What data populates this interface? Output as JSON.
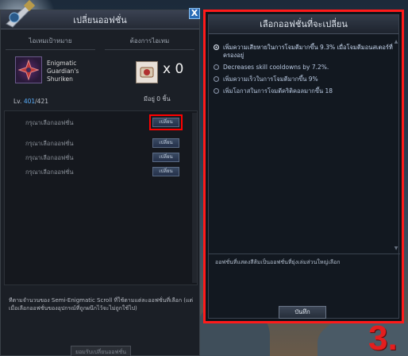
{
  "left_panel": {
    "title": "เปลี่ยนออฟชั่น",
    "close_label": "X",
    "col_headers": [
      "ไอเทมเป้าหมาย",
      "ต้องการไอเทม"
    ],
    "item": {
      "name": "Enigmatic Guardian's Shuriken",
      "level_prefix": "Lv.",
      "level_current": "401",
      "level_max": "/421"
    },
    "scroll": {
      "count": "x 0",
      "owned": "มีอยู่ 0 ชิ้น"
    },
    "options": [
      {
        "label": "กรุณาเลือกออฟชั่น",
        "button": "เปลี่ยน"
      },
      {
        "label": "กรุณาเลือกออฟชั่น",
        "button": "เปลี่ยน"
      },
      {
        "label": "กรุณาเลือกออฟชั่น",
        "button": "เปลี่ยน"
      },
      {
        "label": "กรุณาเลือกออฟชั่น",
        "button": "เปลี่ยน"
      }
    ],
    "note": "ทีตามจำนวนของ Semi-Enigmatic Scroll ที่ใช้ตามแต่ละออฟชั่นที่เลือก (แต่เมื่อเลือกออฟชั่นของอุปกรณ์ที่ถูกผนึกไว้จะไม่ถูกใช้ไป)",
    "bottom_button": "ยอมรับเปลี่ยนออฟชั่น"
  },
  "right_panel": {
    "title": "เลือกออฟชั่นที่จะเปลี่ยน",
    "options": [
      {
        "text": "เพิ่มความเสียหายในการโจมตีมากขึ้น 9.3% เมื่อโจมตีมอนสเตอร์ที่ครองอยู่",
        "selected": true
      },
      {
        "text": "Decreases skill cooldowns by 7.2%.",
        "selected": false
      },
      {
        "text": "เพิ่มความเร็วในการโจมตีมากขึ้น 9%",
        "selected": false
      },
      {
        "text": "เพิ่มโอกาสในการโจมตีคริติคอลมากขึ้น 18",
        "selected": false
      }
    ],
    "note": "ออฟชั่นที่แสดงสีส้มเป็นออฟชั่นที่ยุ่งเล่มส่วนใหญ่เลือก",
    "save_button": "บันทึก"
  },
  "step_label": "3.",
  "colors": {
    "highlight": "#ff1a1a",
    "level": "#5ab0ff",
    "step": "#e41e1e"
  }
}
